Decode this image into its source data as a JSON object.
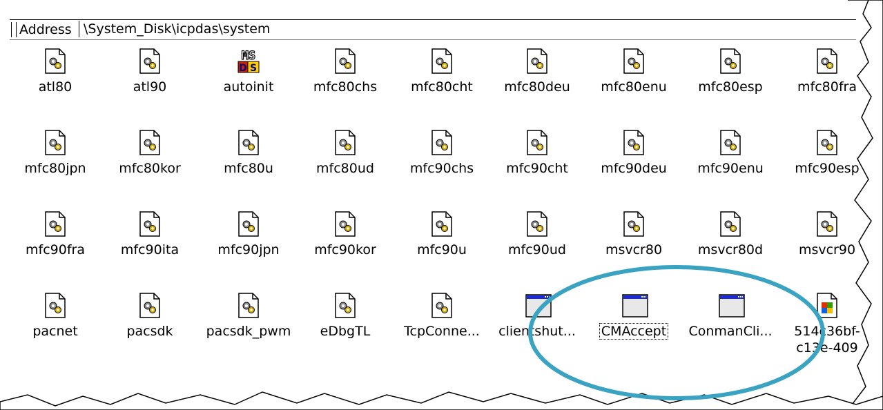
{
  "address": {
    "label": "Address",
    "path": "\\System_Disk\\icpdas\\system"
  },
  "items": [
    {
      "label": "atl80",
      "icon": "dll-file-icon"
    },
    {
      "label": "atl90",
      "icon": "dll-file-icon"
    },
    {
      "label": "autoinit",
      "icon": "msdos-icon"
    },
    {
      "label": "mfc80chs",
      "icon": "dll-file-icon"
    },
    {
      "label": "mfc80cht",
      "icon": "dll-file-icon"
    },
    {
      "label": "mfc80deu",
      "icon": "dll-file-icon"
    },
    {
      "label": "mfc80enu",
      "icon": "dll-file-icon"
    },
    {
      "label": "mfc80esp",
      "icon": "dll-file-icon"
    },
    {
      "label": "mfc80fra",
      "icon": "dll-file-icon"
    },
    {
      "label": "mfc80jpn",
      "icon": "dll-file-icon"
    },
    {
      "label": "mfc80kor",
      "icon": "dll-file-icon"
    },
    {
      "label": "mfc80u",
      "icon": "dll-file-icon"
    },
    {
      "label": "mfc80ud",
      "icon": "dll-file-icon"
    },
    {
      "label": "mfc90chs",
      "icon": "dll-file-icon"
    },
    {
      "label": "mfc90cht",
      "icon": "dll-file-icon"
    },
    {
      "label": "mfc90deu",
      "icon": "dll-file-icon"
    },
    {
      "label": "mfc90enu",
      "icon": "dll-file-icon"
    },
    {
      "label": "mfc90esp",
      "icon": "dll-file-icon"
    },
    {
      "label": "mfc90fra",
      "icon": "dll-file-icon"
    },
    {
      "label": "mfc90ita",
      "icon": "dll-file-icon"
    },
    {
      "label": "mfc90jpn",
      "icon": "dll-file-icon"
    },
    {
      "label": "mfc90kor",
      "icon": "dll-file-icon"
    },
    {
      "label": "mfc90u",
      "icon": "dll-file-icon"
    },
    {
      "label": "mfc90ud",
      "icon": "dll-file-icon"
    },
    {
      "label": "msvcr80",
      "icon": "dll-file-icon"
    },
    {
      "label": "msvcr80d",
      "icon": "dll-file-icon"
    },
    {
      "label": "msvcr90",
      "icon": "dll-file-icon"
    },
    {
      "label": "pacnet",
      "icon": "dll-file-icon"
    },
    {
      "label": "pacsdk",
      "icon": "dll-file-icon"
    },
    {
      "label": "pacsdk_pwm",
      "icon": "dll-file-icon"
    },
    {
      "label": "eDbgTL",
      "icon": "dll-file-icon"
    },
    {
      "label": "TcpConne...",
      "icon": "dll-file-icon"
    },
    {
      "label": "clientshut...",
      "icon": "application-icon"
    },
    {
      "label": "CMAccept",
      "icon": "application-icon",
      "focused": true
    },
    {
      "label": "ConmanCli...",
      "icon": "application-icon"
    },
    {
      "label": "514c36bf-c13e-409",
      "icon": "setup-icon"
    }
  ],
  "highlight_color": "#3aa3c2"
}
